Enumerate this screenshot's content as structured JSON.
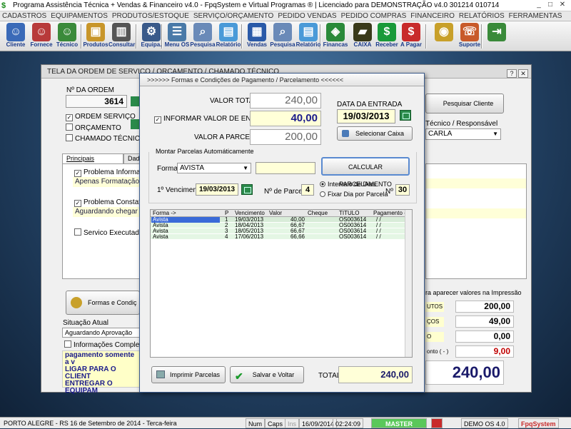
{
  "window": {
    "title": "Programa Assistência Técnica + Vendas & Financeiro v4.0 - FpqSystem e Virtual Programas ® | Licenciado para  DEMONSTRAÇÃO v4.0 301214 010714"
  },
  "menu": [
    "CADASTROS",
    "EQUIPAMENTOS",
    "PRODUTOS/ESTOQUE",
    "SERVIÇO/ORÇAMENTO",
    "PEDIDO VENDAS",
    "PEDIDO COMPRAS",
    "FINANCEIRO",
    "RELATÓRIOS",
    "FERRAMENTAS",
    "AJUDA"
  ],
  "toolbar": [
    {
      "label": "Cliente",
      "icon": "person-icon",
      "color": "#3a6ab8"
    },
    {
      "label": "Fornece",
      "icon": "supplier-icon",
      "color": "#b83a3a"
    },
    {
      "label": "Técnico",
      "icon": "technician-icon",
      "color": "#3a8a3a"
    },
    {
      "label": "Produtos",
      "icon": "boxes-icon",
      "color": "#c8962a"
    },
    {
      "label": "Consultar",
      "icon": "barcode-icon",
      "color": "#555555"
    },
    {
      "label": "Equipa.",
      "icon": "equipment-icon",
      "color": "#3a5a8a"
    },
    {
      "label": "Menu OS",
      "icon": "os-menu-icon",
      "color": "#4a7aa8"
    },
    {
      "label": "Pesquisa",
      "icon": "search-doc-icon",
      "color": "#6a8ab8"
    },
    {
      "label": "Relatório",
      "icon": "report-icon",
      "color": "#4a9ad8"
    },
    {
      "label": "Vendas",
      "icon": "sales-icon",
      "color": "#2a5aa8"
    },
    {
      "label": "Pesquisa",
      "icon": "search-doc-icon",
      "color": "#6a8ab8"
    },
    {
      "label": "Relatório",
      "icon": "report-icon",
      "color": "#4a9ad8"
    },
    {
      "label": "Financas",
      "icon": "finance-icon",
      "color": "#2a8a3a"
    },
    {
      "label": "CAIXA",
      "icon": "cashbox-icon",
      "color": "#3a3a1a"
    },
    {
      "label": "Receber",
      "icon": "dollar-green-icon",
      "color": "#1a9a3a"
    },
    {
      "label": "A Pagar",
      "icon": "dollar-red-icon",
      "color": "#c82a2a"
    },
    {
      "label": "",
      "icon": "coins-icon",
      "color": "#c8a02a"
    },
    {
      "label": "Suporte",
      "icon": "support-icon",
      "color": "#c85a2a"
    },
    {
      "label": "",
      "icon": "exit-icon",
      "color": "#3a8a3a"
    }
  ],
  "os_window": {
    "title": "TELA DA ORDEM DE SERVIÇO / ORÇAMENTO / CHAMADO TÉCNICO",
    "order_label": "Nº DA ORDEM",
    "order_number": "3614",
    "types": [
      {
        "label": "ORDEM SERVIÇO",
        "checked": true
      },
      {
        "label": "ORÇAMENTO",
        "checked": false
      },
      {
        "label": "CHAMADO TÉCNICO",
        "checked": false
      }
    ],
    "search_client": "Pesquisar Cliente",
    "tech_label": "Técnico / Responsável",
    "tech_value": "CARLA",
    "tabs": [
      "Principais Informações",
      "Dad"
    ],
    "problem_informed_label": "Problema Informado:",
    "problem_informed_value": "Apenas Formatação",
    "problem_found_label": "Problema Constatado:",
    "problem_found_value": "Aguardando chegar",
    "service_done_label": "Servico Executado:",
    "payment_button": "Formas e Condiç",
    "status_label": "Situação Atual",
    "status_value": "Aguardando Aprovação",
    "extra_info_label": "Informações Complementar",
    "notes": [
      "pagamento somente a v",
      "LIGAR PARA O CLIENT",
      "ENTREGAR O EQUIPAM"
    ],
    "print_note": "ra aparecer valores na Impressão",
    "summary": [
      {
        "tag": "UTOS",
        "value": "200,00",
        "color": "#000000"
      },
      {
        "tag": "ÇOS",
        "value": "49,00",
        "color": "#000000"
      },
      {
        "tag": "O",
        "value": "0,00",
        "color": "#000000"
      },
      {
        "tag": "onto ( - )",
        "value": "9,00",
        "color": "#c00000"
      }
    ],
    "grand_total": "240,00"
  },
  "dialog": {
    "title": ">>>>>> Formas e Condições de Pagamento / Parcelamento <<<<<<",
    "total_label": "VALOR TOTAL",
    "total_value": "240,00",
    "entry_label": "INFORMAR VALOR DE ENTRADA",
    "entry_value": "40,00",
    "parcel_label": "VALOR A PARCELAR",
    "parcel_value": "200,00",
    "entry_date_label": "DATA DA ENTRADA",
    "entry_date": "19/03/2013",
    "select_cash": "Selecionar Caixa",
    "auto_label": "Montar Parcelas Automáticamente",
    "form_label": "Forma:",
    "form_value": "AVISTA",
    "calc_button": "CALCULAR  PARCELAMENTO",
    "first_due_label": "1º Vencimento:",
    "first_due": "19/03/2013",
    "num_parcels_label": "Nº de Parcelas",
    "num_parcels": "4",
    "interval_label": "Intervalo de Dias",
    "fixed_day_label": "Fixar Dia por Parcela",
    "n_label": "Nº",
    "n_value": "30",
    "grid_headers": [
      "Forma ->",
      "P",
      "Vencimento",
      "Valor",
      "Cheque",
      "TITULO",
      "Pagamento ->"
    ],
    "rows": [
      {
        "forma": "Avista",
        "p": "1",
        "venc": "19/03/2013",
        "valor": "40,00",
        "cheque": "",
        "titulo": "OS003614",
        "pag": "/  /"
      },
      {
        "forma": "Avista",
        "p": "2",
        "venc": "18/04/2013",
        "valor": "66,67",
        "cheque": "",
        "titulo": "OS003614",
        "pag": "/  /"
      },
      {
        "forma": "Avista",
        "p": "3",
        "venc": "18/05/2013",
        "valor": "66,67",
        "cheque": "",
        "titulo": "OS003614",
        "pag": "/  /"
      },
      {
        "forma": "Avista",
        "p": "4",
        "venc": "17/06/2013",
        "valor": "66,66",
        "cheque": "",
        "titulo": "OS003614",
        "pag": "/  /"
      }
    ],
    "print_button": "Imprimir Parcelas",
    "save_button": "Salvar e Voltar",
    "total_footer_label": "TOTAL",
    "total_footer": "240,00"
  },
  "statusbar": {
    "location": "PORTO ALEGRE - RS 16 de Setembro de 2014 - Terca-feira",
    "num": "Num",
    "caps": "Caps",
    "ins": "Ins",
    "date": "16/09/2014",
    "time": "02:24:09",
    "master": "MASTER",
    "demo": "DEMO OS 4.0",
    "brand": "FpqSystem"
  }
}
